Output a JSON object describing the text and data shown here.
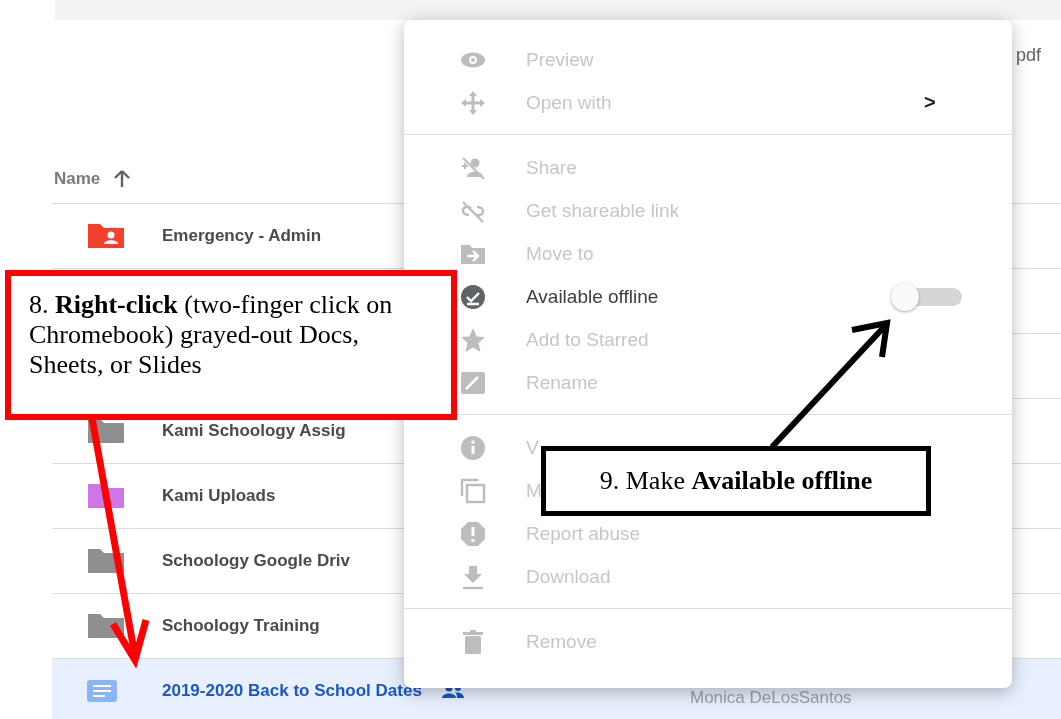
{
  "top_bar": {
    "partial_text": "pdf"
  },
  "file_list": {
    "header": {
      "label": "Name"
    },
    "rows": [
      {
        "kind": "shared-folder",
        "name": "Emergency - Admin",
        "color": "#f4402c",
        "selected": false
      },
      {
        "kind": "hidden",
        "selected": false
      },
      {
        "kind": "hidden",
        "selected": false
      },
      {
        "kind": "folder",
        "name": "Kami Schoology Assig",
        "color": "#8f8f8f",
        "selected": false
      },
      {
        "kind": "folder",
        "name": "Kami Uploads",
        "color": "#cf76e6",
        "selected": false
      },
      {
        "kind": "folder",
        "name": "Schoology Google Driv",
        "color": "#8f8f8f",
        "selected": false
      },
      {
        "kind": "folder",
        "name": "Schoology Training",
        "color": "#8f8f8f",
        "selected": false
      },
      {
        "kind": "doc",
        "name": "2019-2020 Back to School Dates",
        "shared": true,
        "owner": "Monica DeLosSantos",
        "color": "#8ab4f8",
        "selected": true
      }
    ]
  },
  "context_menu": {
    "items": [
      {
        "kind": "item",
        "label": "Preview",
        "disabled": true
      },
      {
        "kind": "item",
        "label": "Open with",
        "disabled": true,
        "submenu": ">"
      },
      {
        "kind": "divider"
      },
      {
        "kind": "item",
        "label": "Share",
        "disabled": true
      },
      {
        "kind": "item",
        "label": "Get shareable link",
        "disabled": true
      },
      {
        "kind": "item",
        "label": "Move to",
        "disabled": true
      },
      {
        "kind": "toggle",
        "label": "Available offline",
        "disabled": false,
        "on": false
      },
      {
        "kind": "item",
        "label": "Add to Starred",
        "disabled": true
      },
      {
        "kind": "item",
        "label": "Rename",
        "disabled": true
      },
      {
        "kind": "divider"
      },
      {
        "kind": "item",
        "label": "V",
        "disabled": true
      },
      {
        "kind": "item",
        "label": "M",
        "disabled": true
      },
      {
        "kind": "item",
        "label": "Report abuse",
        "disabled": true
      },
      {
        "kind": "item",
        "label": "Download",
        "disabled": true
      },
      {
        "kind": "divider"
      },
      {
        "kind": "item",
        "label": "Remove",
        "disabled": true
      }
    ]
  },
  "annotations": [
    {
      "kind": "red",
      "text": "8. **Right-click** (two-finger click on Chromebook) grayed-out Docs, Sheets, or Slides"
    },
    {
      "kind": "black",
      "text": "9. Make **Available offline**"
    }
  ]
}
